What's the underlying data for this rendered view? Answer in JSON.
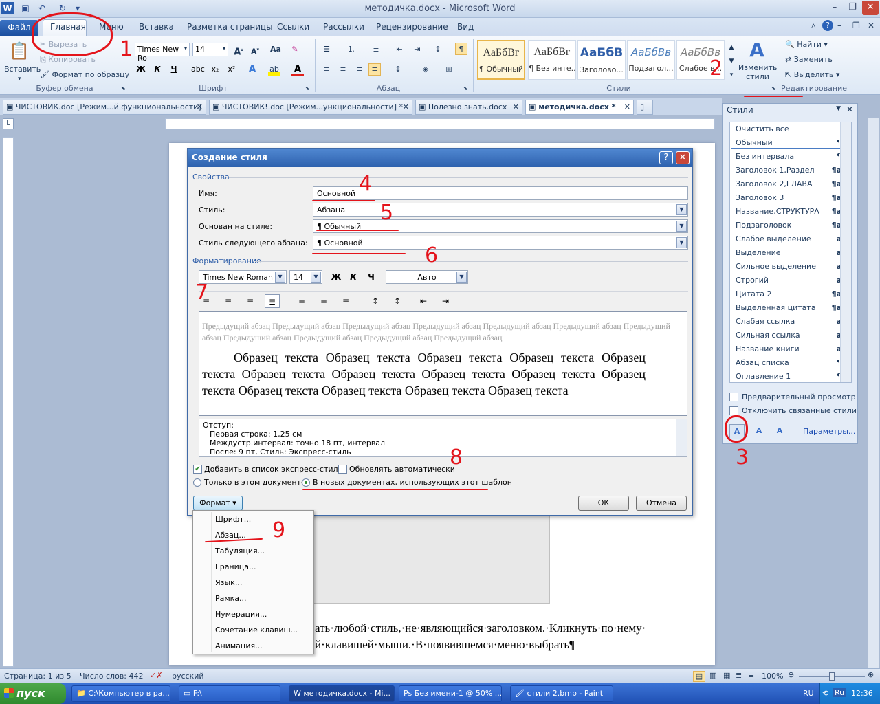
{
  "window": {
    "title": "методичка.docx - Microsoft Word"
  },
  "ribbon": {
    "file": "Файл",
    "tabs": [
      "Главная",
      "Меню",
      "Вставка",
      "Разметка страницы",
      "Ссылки",
      "Рассылки",
      "Рецензирование",
      "Вид"
    ],
    "clipboard": {
      "paste": "Вставить",
      "cut": "Вырезать",
      "copy": "Копировать",
      "painter": "Формат по образцу",
      "label": "Буфер обмена"
    },
    "font": {
      "name": "Times New Ro",
      "size": "14",
      "label": "Шрифт"
    },
    "paragraph": {
      "label": "Абзац"
    },
    "styles": {
      "label": "Стили",
      "items": [
        {
          "sample": "АаБбВг",
          "name": "¶ Обычный"
        },
        {
          "sample": "АаБбВг",
          "name": "¶ Без инте..."
        },
        {
          "sample": "АаБбВ",
          "name": "Заголово..."
        },
        {
          "sample": "АаБбВв",
          "name": "Подзагол..."
        },
        {
          "sample": "АаБбВв",
          "name": "Слабое в..."
        }
      ],
      "change": "Изменить стили"
    },
    "editing": {
      "find": "Найти",
      "replace": "Заменить",
      "select": "Выделить",
      "label": "Редактирование"
    }
  },
  "doc_tabs": [
    "ЧИСТОВИК.doc [Режим...й функциональности]",
    "ЧИСТОВИК!.doc [Режим...ункциональности]  *",
    "Полезно знать.docx",
    "методичка.docx  *"
  ],
  "styles_pane": {
    "title": "Стили",
    "items": [
      {
        "name": "Очистить все",
        "mark": ""
      },
      {
        "name": "Обычный",
        "mark": "¶"
      },
      {
        "name": "Без интервала",
        "mark": "¶"
      },
      {
        "name": "Заголовок 1,Раздел",
        "mark": "¶a"
      },
      {
        "name": "Заголовок 2,ГЛАВА",
        "mark": "¶a"
      },
      {
        "name": "Заголовок 3",
        "mark": "¶a"
      },
      {
        "name": "Название,СТРУКТУРА",
        "mark": "¶a"
      },
      {
        "name": "Подзаголовок",
        "mark": "¶a"
      },
      {
        "name": "Слабое выделение",
        "mark": "a"
      },
      {
        "name": "Выделение",
        "mark": "a"
      },
      {
        "name": "Сильное выделение",
        "mark": "a"
      },
      {
        "name": "Строгий",
        "mark": "a"
      },
      {
        "name": "Цитата 2",
        "mark": "¶a"
      },
      {
        "name": "Выделенная цитата",
        "mark": "¶a"
      },
      {
        "name": "Слабая ссылка",
        "mark": "a"
      },
      {
        "name": "Сильная ссылка",
        "mark": "a"
      },
      {
        "name": "Название книги",
        "mark": "a"
      },
      {
        "name": "Абзац списка",
        "mark": "¶"
      },
      {
        "name": "Оглавление 1",
        "mark": "¶"
      }
    ],
    "preview": "Предварительный просмотр",
    "disable_linked": "Отключить связанные стили",
    "params": "Параметры..."
  },
  "dialog": {
    "title": "Создание стиля",
    "props_label": "Свойства",
    "name_label": "Имя:",
    "name_value": "Основной",
    "style_label": "Стиль:",
    "style_value": "Абзаца",
    "based_label": "Основан на стиле:",
    "based_value": "¶  Обычный",
    "next_label": "Стиль следующего абзаца:",
    "next_value": "¶  Основной",
    "format_label": "Форматирование",
    "font": "Times New Roman",
    "size": "14",
    "bold": "Ж",
    "italic": "К",
    "underline": "Ч",
    "color": "Авто",
    "preview_prev": "Предыдущий абзац Предыдущий абзац Предыдущий абзац Предыдущий абзац Предыдущий абзац Предыдущий абзац Предыдущий абзац Предыдущий абзац Предыдущий абзац Предыдущий абзац Предыдущий абзац",
    "preview_sample": "Образец текста Образец текста Образец текста Образец текста Образец текста Образец текста Образец текста Образец текста Образец текста Образец текста Образец текста Образец текста Образец текста Образец текста",
    "desc_1": "Отступ:",
    "desc_2": "Первая строка:  1,25 см",
    "desc_3": "Междустр.интервал:  точно 18 пт, интервал",
    "desc_4": "После:  9 пт, Стиль: Экспресс-стиль",
    "add_quick": "Добавить в список экспресс-стилей",
    "auto_update": "Обновлять автоматически",
    "only_doc": "Только в этом документе",
    "new_docs": "В новых документах, использующих этот шаблон",
    "format_btn": "Формат",
    "ok": "ОК",
    "cancel": "Отмена"
  },
  "format_menu": [
    "Шрифт...",
    "Абзац...",
    "Табуляция...",
    "Граница...",
    "Язык...",
    "Рамка...",
    "Нумерация...",
    "Сочетание клавиш...",
    "Анимация..."
  ],
  "document": {
    "line1": "ать·любой·стиль,·не·являющийся·заголовком.·Кликнуть·по·нему·",
    "line2": "й·клавишей·мыши.·В·появившемся·меню·выбрать¶"
  },
  "annotations": [
    "1",
    "2",
    "3",
    "4",
    "5",
    "6",
    "7",
    "8",
    "9"
  ],
  "status": {
    "page": "Страница: 1 из 5",
    "words": "Число слов: 442",
    "lang": "русский",
    "zoom": "100%"
  },
  "taskbar": {
    "start": "пуск",
    "items": [
      "C:\\Компьютер  в ра...",
      "F:\\",
      "методичка.docx - Mi...",
      "Без имени-1 @ 50% ...",
      "стили 2.bmp - Paint"
    ],
    "lang": "RU",
    "lang2": "Ru",
    "time": "12:36"
  },
  "colors": {
    "annotation": "#e4141b",
    "title_bar": "#2e62ae"
  }
}
